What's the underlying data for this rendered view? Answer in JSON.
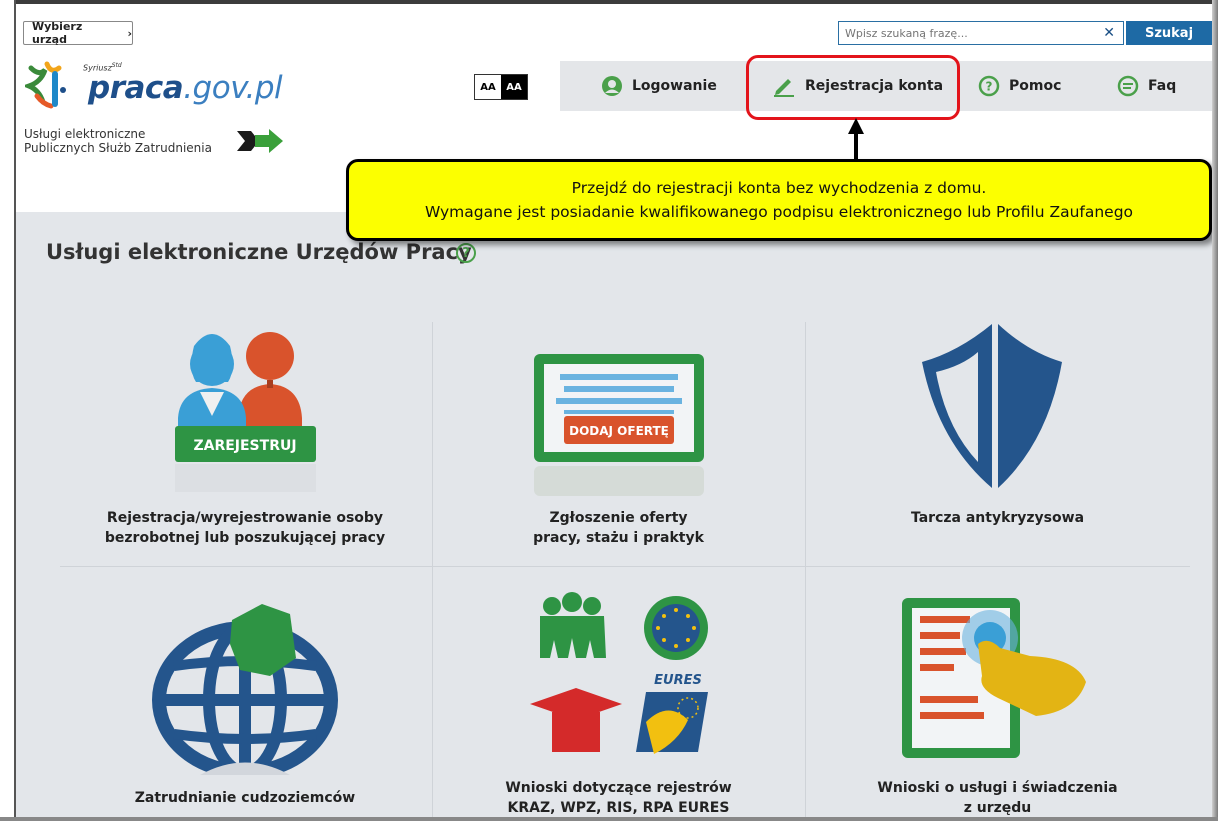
{
  "top": {
    "select_office_label": "Wybierz urząd",
    "search_placeholder": "Wpisz szukaną frazę...",
    "search_button": "Szukaj"
  },
  "logo": {
    "prefix": "Syriusz",
    "prefix_sup": "Std",
    "brand_main": "praca",
    "brand_suffix": ".gov.pl",
    "tagline_line1": "Usługi elektroniczne",
    "tagline_line2": "Publicznych Służb Zatrudnienia"
  },
  "font_size": {
    "small": "AA",
    "large": "AA"
  },
  "nav": {
    "items": [
      {
        "label": "Logowanie",
        "icon": "user-circle-icon"
      },
      {
        "label": "Rejestracja konta",
        "icon": "pencil-icon"
      },
      {
        "label": "Pomoc",
        "icon": "question-circle-icon"
      },
      {
        "label": "Faq",
        "icon": "chat-bubble-icon"
      }
    ]
  },
  "callout": {
    "line1": "Przejdź do rejestracji konta bez wychodzenia z domu.",
    "line2": "Wymagane jest posiadanie kwalifikowanego podpisu elektronicznego lub Profilu Zaufanego"
  },
  "main": {
    "title": "Usługi elektroniczne Urzędów Pracy",
    "help_icon": "?",
    "tiles": [
      {
        "line1": "Rejestracja/wyrejestrowanie osoby",
        "line2": "bezrobotnej lub poszukującej pracy",
        "badge": "ZAREJESTRUJ"
      },
      {
        "line1": "Zgłoszenie oferty",
        "line2": "pracy, stażu i praktyk",
        "badge": "DODAJ OFERTĘ"
      },
      {
        "line1": "Tarcza antykryzysowa",
        "line2": ""
      },
      {
        "line1": "Zatrudnianie cudzoziemców",
        "line2": ""
      },
      {
        "line1": "Wnioski dotyczące rejestrów",
        "line2": "KRAZ, WPZ, RIS, RPA EURES",
        "badge": "EURES"
      },
      {
        "line1": "Wnioski o usługi i świadczenia",
        "line2": "z urzędu"
      }
    ]
  },
  "colors": {
    "brand_blue": "#1e4f8a",
    "search_blue": "#1e6aa5",
    "highlight_red": "#e3141b",
    "callout_yellow": "#fcff00",
    "green": "#4aa04a"
  }
}
